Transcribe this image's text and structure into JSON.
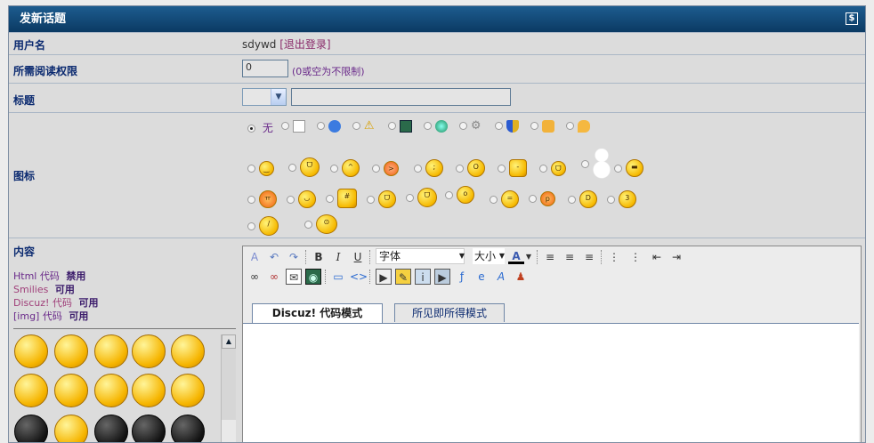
{
  "header": {
    "title": "发新话题",
    "icon": "$"
  },
  "username": {
    "label": "用户名",
    "name": "sdywd",
    "logout": "[退出登录]"
  },
  "readperm": {
    "label": "所需阅读权限",
    "value": "0",
    "hint": "(0或空为不限制)"
  },
  "subject": {
    "label": "标题",
    "select_value": "",
    "input_value": ""
  },
  "icons": {
    "label": "图标",
    "none_label": "无",
    "row1": [
      "blank-page-icon",
      "question-icon",
      "warning-icon",
      "picture-icon",
      "globe-icon",
      "gear-icon",
      "shield-icon",
      "thumb-icon",
      "speech-icon"
    ],
    "row2": [
      "smile",
      "grin",
      "happy",
      "angry",
      "wink",
      "scream",
      "blink",
      "laugh",
      "snowman",
      "cool"
    ],
    "row3": [
      "cry",
      "shy",
      "mad",
      "sweat",
      "lol",
      "doubt",
      "ugh",
      "tongue",
      "laugh2",
      "kiss"
    ],
    "row4": [
      "sorry",
      "shock"
    ]
  },
  "content": {
    "label": "内容",
    "html_code": "Html 代码",
    "html_status": "禁用",
    "smilies": "Smilies",
    "smilies_status": "可用",
    "discuz_code": "Discuz! 代码",
    "discuz_status": "可用",
    "img_code": "[img] 代码",
    "img_status": "可用"
  },
  "editor": {
    "font_label": "字体",
    "size_label": "大小",
    "tab_discuz": "Discuz! 代码模式",
    "tab_wysiwyg": "所见即所得模式",
    "text": ""
  },
  "colors": {
    "header": "#0b3a63",
    "label": "#0b2a70",
    "accent": "#6a2a8a"
  }
}
